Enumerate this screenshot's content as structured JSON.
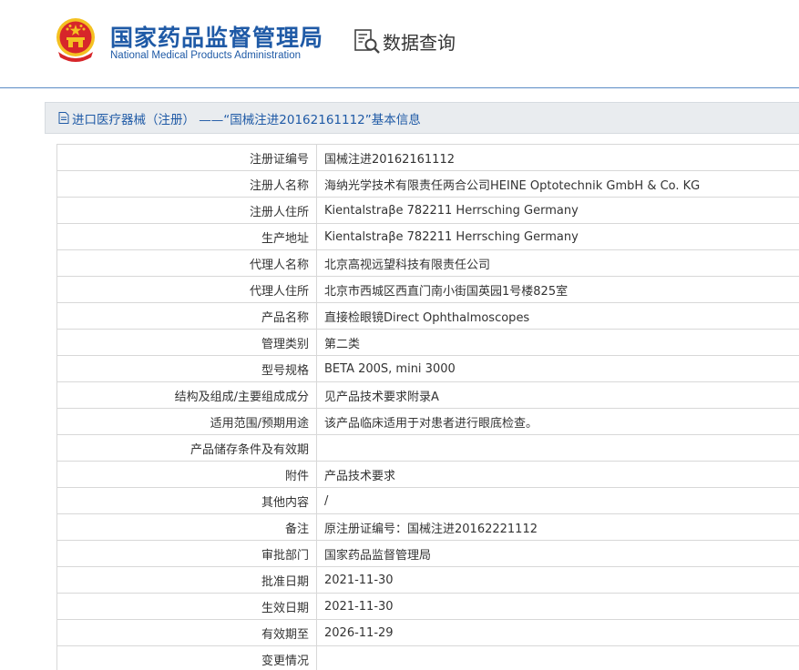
{
  "header": {
    "title_cn": "国家药品监督管理局",
    "title_en": "National Medical Products Administration",
    "query_label": "数据查询",
    "colors": {
      "brand": "#1f5aa6",
      "emblem_red": "#d7262a",
      "emblem_gold": "#f4c121"
    }
  },
  "subheader": {
    "icon": "document-icon",
    "title": "进口医疗器械（注册） ——“国械注进20162161112”基本信息"
  },
  "rows": [
    {
      "label": "注册证编号",
      "value": "国械注进20162161112"
    },
    {
      "label": "注册人名称",
      "value": "海纳光学技术有限责任两合公司HEINE Optotechnik GmbH & Co. KG"
    },
    {
      "label": "注册人住所",
      "value": "Kientalstraβe 782211 Herrsching Germany"
    },
    {
      "label": "生产地址",
      "value": "Kientalstraβe 782211 Herrsching Germany"
    },
    {
      "label": "代理人名称",
      "value": "北京高视远望科技有限责任公司"
    },
    {
      "label": "代理人住所",
      "value": "北京市西城区西直门南小街国英园1号楼825室"
    },
    {
      "label": "产品名称",
      "value": "直接检眼镜Direct Ophthalmoscopes"
    },
    {
      "label": "管理类别",
      "value": "第二类"
    },
    {
      "label": "型号规格",
      "value": "BETA 200S, mini 3000"
    },
    {
      "label": "结构及组成/主要组成成分",
      "value": "见产品技术要求附录A"
    },
    {
      "label": "适用范围/预期用途",
      "value": "该产品临床适用于对患者进行眼底检查。"
    },
    {
      "label": "产品储存条件及有效期",
      "value": ""
    },
    {
      "label": "附件",
      "value": "产品技术要求"
    },
    {
      "label": "其他内容",
      "value": "/"
    },
    {
      "label": "备注",
      "value": "原注册证编号：国械注进20162221112"
    },
    {
      "label": "审批部门",
      "value": "国家药品监督管理局"
    },
    {
      "label": "批准日期",
      "value": "2021-11-30"
    },
    {
      "label": "生效日期",
      "value": "2021-11-30"
    },
    {
      "label": "有效期至",
      "value": "2026-11-29"
    },
    {
      "label": "变更情况",
      "value": ""
    }
  ]
}
